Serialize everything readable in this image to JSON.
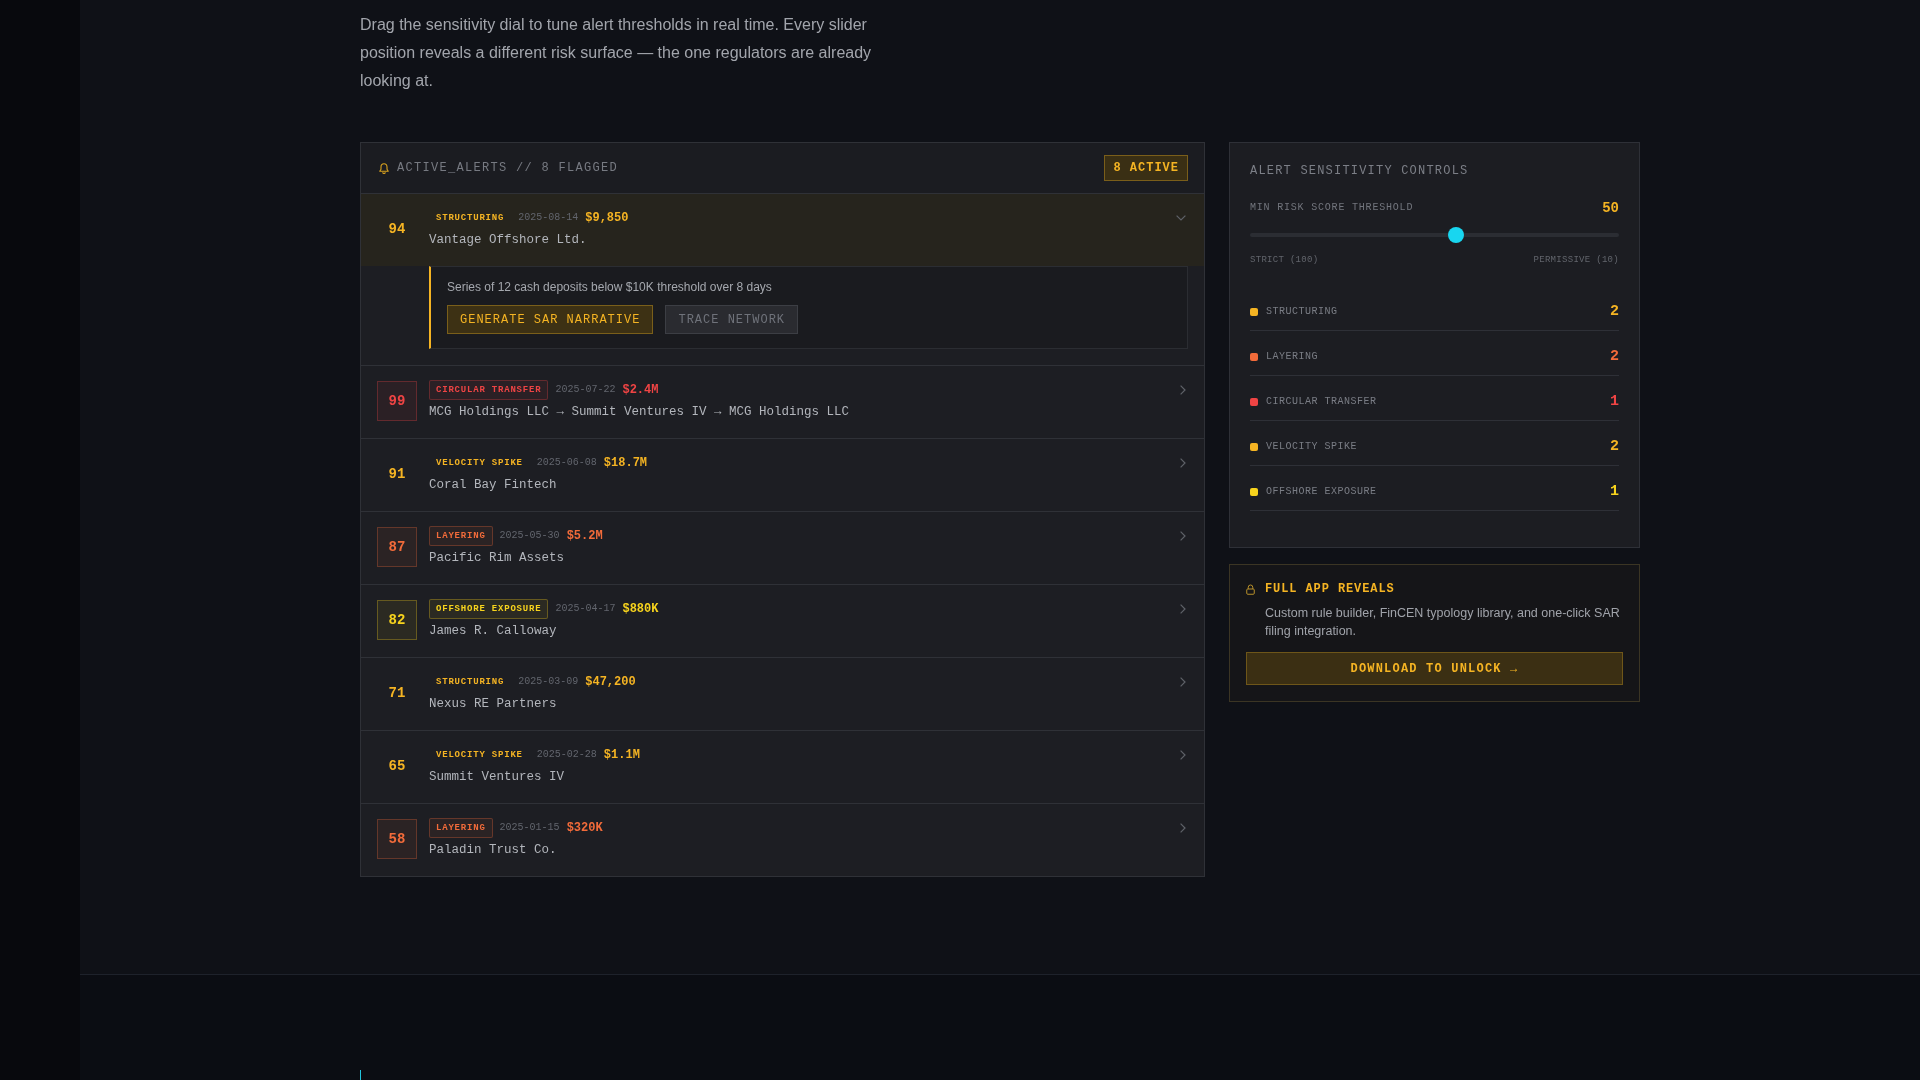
{
  "intro": "Drag the sensitivity dial to tune alert thresholds in real time. Every slider position reveals a different risk surface — the one regulators are already looking at.",
  "alerts_panel": {
    "title": "ACTIVE_ALERTS // 8 FLAGGED",
    "badge": "8 ACTIVE",
    "alerts": [
      {
        "score": "94",
        "tag": "STRUCTURING",
        "date": "2025-08-14",
        "amount": "$9,850",
        "entity": "Vantage Offshore Ltd.",
        "color": "#f5b423",
        "outlined": false,
        "expanded": true,
        "detail": {
          "text": "Series of 12 cash deposits below $10K threshold over 8 days",
          "actions": [
            {
              "label": "GENERATE SAR NARRATIVE",
              "kind": "primary"
            },
            {
              "label": "TRACE NETWORK",
              "kind": "secondary"
            }
          ]
        }
      },
      {
        "score": "99",
        "tag": "CIRCULAR TRANSFER",
        "date": "2025-07-22",
        "amount": "$2.4M",
        "entity": "MCG Holdings LLC → Summit Ventures IV → MCG Holdings LLC",
        "color": "#ef4444",
        "outlined": true,
        "expanded": false
      },
      {
        "score": "91",
        "tag": "VELOCITY SPIKE",
        "date": "2025-06-08",
        "amount": "$18.7M",
        "entity": "Coral Bay Fintech",
        "color": "#f5b423",
        "outlined": false,
        "expanded": false
      },
      {
        "score": "87",
        "tag": "LAYERING",
        "date": "2025-05-30",
        "amount": "$5.2M",
        "entity": "Pacific Rim Assets",
        "color": "#f26b3a",
        "outlined": true,
        "expanded": false
      },
      {
        "score": "82",
        "tag": "OFFSHORE EXPOSURE",
        "date": "2025-04-17",
        "amount": "$880K",
        "entity": "James R. Calloway",
        "color": "#f7d31d",
        "outlined": true,
        "expanded": false
      },
      {
        "score": "71",
        "tag": "STRUCTURING",
        "date": "2025-03-09",
        "amount": "$47,200",
        "entity": "Nexus RE Partners",
        "color": "#f5b423",
        "outlined": false,
        "expanded": false
      },
      {
        "score": "65",
        "tag": "VELOCITY SPIKE",
        "date": "2025-02-28",
        "amount": "$1.1M",
        "entity": "Summit Ventures IV",
        "color": "#f5b423",
        "outlined": false,
        "expanded": false
      },
      {
        "score": "58",
        "tag": "LAYERING",
        "date": "2025-01-15",
        "amount": "$320K",
        "entity": "Paladin Trust Co.",
        "color": "#f26b3a",
        "outlined": true,
        "expanded": false
      }
    ]
  },
  "controls": {
    "title": "ALERT SENSITIVITY CONTROLS",
    "slider": {
      "label": "MIN RISK SCORE THRESHOLD",
      "value": "50",
      "level": 0.56,
      "min_label": "STRICT (100)",
      "max_label": "PERMISSIVE (10)"
    },
    "typologies": [
      {
        "label": "STRUCTURING",
        "count": "2",
        "color": "#f5b423"
      },
      {
        "label": "LAYERING",
        "count": "2",
        "color": "#f26b3a"
      },
      {
        "label": "CIRCULAR TRANSFER",
        "count": "1",
        "color": "#ef4444"
      },
      {
        "label": "VELOCITY SPIKE",
        "count": "2",
        "color": "#f5b423"
      },
      {
        "label": "OFFSHORE EXPOSURE",
        "count": "1",
        "color": "#f7d31d"
      }
    ]
  },
  "upsell": {
    "title": "FULL APP REVEALS",
    "text": "Custom rule builder, FinCEN typology library, and one-click SAR filing integration.",
    "button": "DOWNLOAD TO UNLOCK →"
  }
}
